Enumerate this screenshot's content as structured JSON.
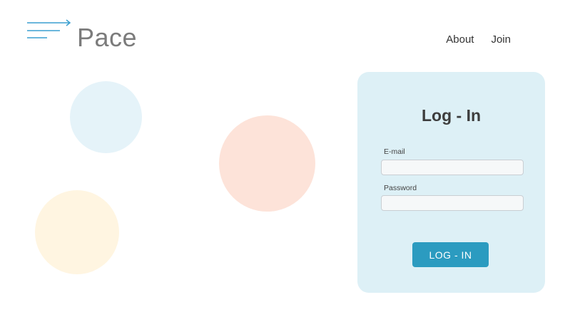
{
  "header": {
    "logo_text": "Pace",
    "logo_icon": "speed-lines-arrow-icon",
    "nav": [
      {
        "label": "About"
      },
      {
        "label": "Join"
      }
    ]
  },
  "login": {
    "title": "Log - In",
    "email_label": "E-mail",
    "email_value": "",
    "password_label": "Password",
    "password_value": "",
    "button_label": "LOG - IN"
  },
  "colors": {
    "accent": "#2b9bc0",
    "logo_lines": "#3a9fd0",
    "card_bg": "#ddf0f6",
    "circle_blue": "#e5f3f9",
    "circle_peach": "#fde3d9",
    "circle_yellow": "#fff5e1"
  }
}
